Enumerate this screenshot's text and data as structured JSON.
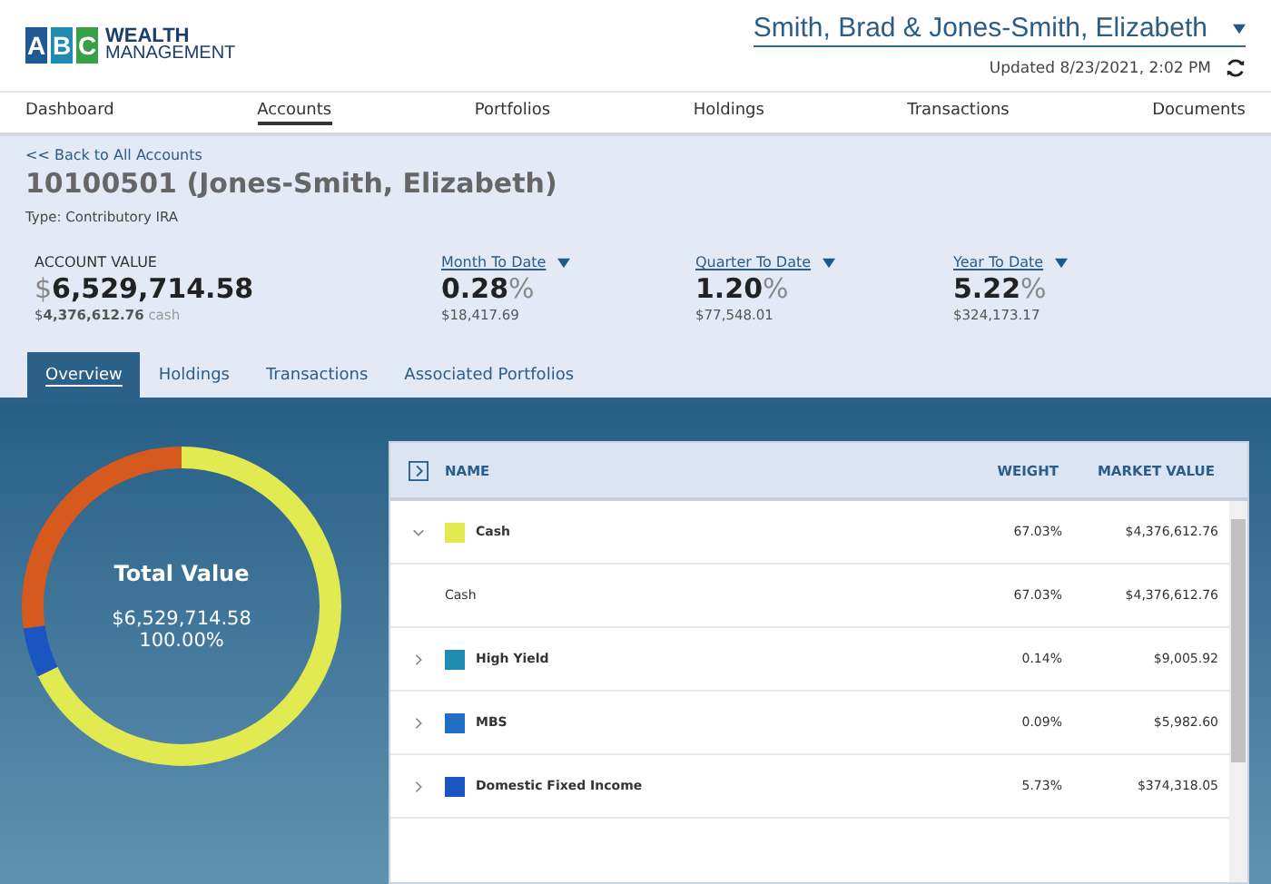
{
  "logo": {
    "letters": [
      "A",
      "B",
      "C"
    ],
    "line_1": "WEALTH",
    "line_2": "MANAGEMENT"
  },
  "client": {
    "name": "Smith, Brad & Jones-Smith, Elizabeth",
    "updated": "Updated 8/23/2021, 2:02 PM"
  },
  "nav": [
    {
      "label": "Dashboard",
      "selected": false
    },
    {
      "label": "Accounts",
      "selected": true
    },
    {
      "label": "Portfolios",
      "selected": false
    },
    {
      "label": "Holdings",
      "selected": false
    },
    {
      "label": "Transactions",
      "selected": false
    },
    {
      "label": "Documents",
      "selected": false
    }
  ],
  "back_link": "<< Back to All Accounts",
  "account": {
    "title": "10100501 (Jones-Smith, Elizabeth)",
    "type": "Type: Contributory IRA"
  },
  "stats": [
    {
      "kind": "value",
      "label": "ACCOUNT VALUE",
      "prefix": "$",
      "amount": "6,529,714.58",
      "sub_prefix": "$",
      "sub_amount": "4,376,612.76",
      "sub_suffix": "cash"
    },
    {
      "kind": "period",
      "label": "Month To Date",
      "amount": "0.28",
      "suffix": "%",
      "sub_prefix": "$",
      "sub_amount": "18,417.69"
    },
    {
      "kind": "period",
      "label": "Quarter To Date",
      "amount": "1.20",
      "suffix": "%",
      "sub_prefix": "$",
      "sub_amount": "77,548.01"
    },
    {
      "kind": "period",
      "label": "Year To Date",
      "amount": "5.22",
      "suffix": "%",
      "sub_prefix": "$",
      "sub_amount": "324,173.17"
    }
  ],
  "tabs": [
    {
      "label": "Overview",
      "selected": true
    },
    {
      "label": "Holdings",
      "selected": false
    },
    {
      "label": "Transactions",
      "selected": false
    },
    {
      "label": "Associated Portfolios",
      "selected": false
    }
  ],
  "donut": {
    "title": "Total Value",
    "value": "$6,529,714.58",
    "percent": "100.00%"
  },
  "table": {
    "columns": [
      "NAME",
      "WEIGHT",
      "MARKET VALUE"
    ],
    "rows": [
      {
        "kind": "group",
        "name": "Cash",
        "color": "#e2ea52",
        "expanded": true,
        "weight": "67.03%",
        "value": "$4,376,612.76"
      },
      {
        "kind": "child",
        "name": "Cash",
        "weight": "67.03%",
        "value": "$4,376,612.76"
      },
      {
        "kind": "group",
        "name": "High Yield",
        "color": "#1f8bb0",
        "expanded": false,
        "weight": "0.14%",
        "value": "$9,005.92"
      },
      {
        "kind": "group",
        "name": "MBS",
        "color": "#1f6fc4",
        "expanded": false,
        "weight": "0.09%",
        "value": "$5,982.60"
      },
      {
        "kind": "group",
        "name": "Domestic Fixed Income",
        "color": "#1a55c2",
        "expanded": false,
        "weight": "5.73%",
        "value": "$374,318.05"
      }
    ]
  }
}
